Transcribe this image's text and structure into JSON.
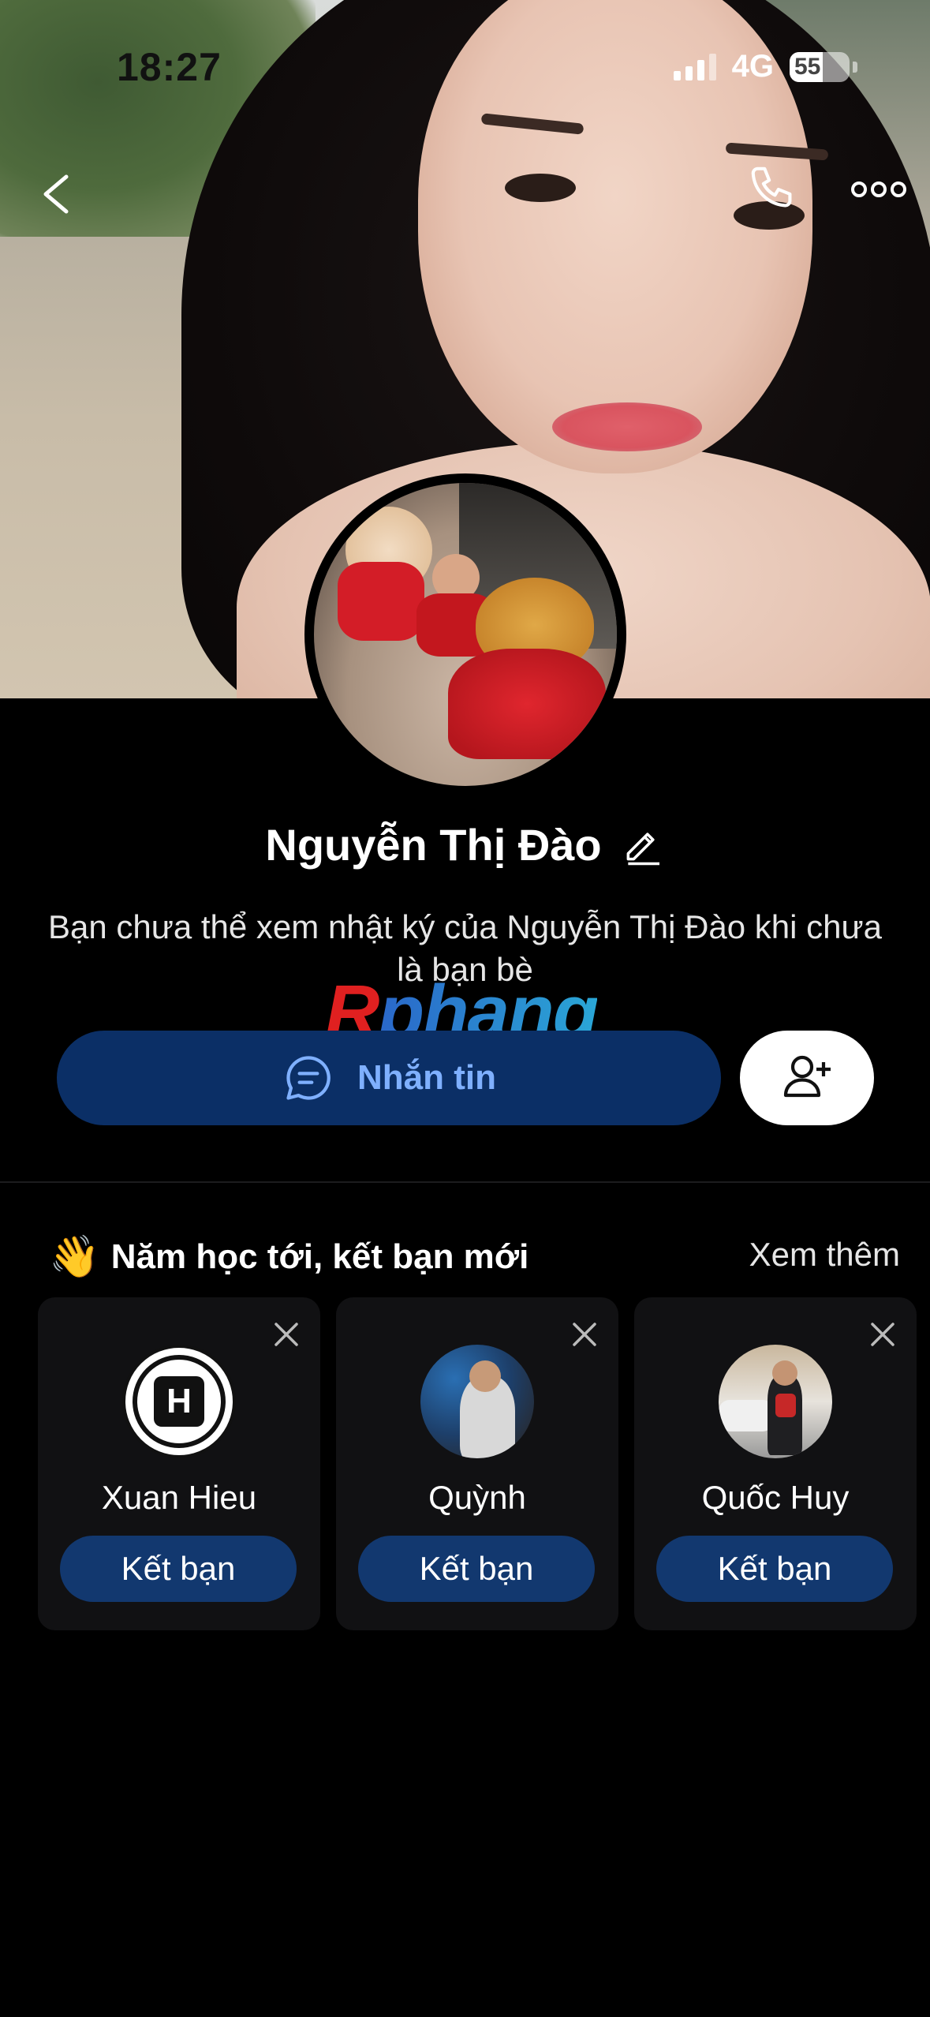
{
  "status_bar": {
    "time": "18:27",
    "network": "4G",
    "battery": "55",
    "battery_level": 0.55
  },
  "nav": {
    "back_icon": "chevron-left-icon",
    "call_icon": "phone-icon",
    "more_icon": "more-dots-icon"
  },
  "profile": {
    "name": "Nguyễn Thị Đào",
    "notice": "Bạn chưa thể xem nhật ký của Nguyễn Thị Đào khi chưa là bạn bè",
    "watermark_r": "R",
    "watermark_rest": "phang"
  },
  "actions": {
    "message_label": "Nhắn tin",
    "add_friend_icon": "add-user-icon"
  },
  "suggestions": {
    "emoji": "👋",
    "title": "Năm học tới, kết bạn mới",
    "see_more": "Xem thêm",
    "items": [
      {
        "name": "Xuan Hieu",
        "button": "Kết bạn",
        "avatar_text": "H"
      },
      {
        "name": "Quỳnh",
        "button": "Kết bạn"
      },
      {
        "name": "Quốc Huy",
        "button": "Kết bạn"
      }
    ]
  },
  "colors": {
    "message_button": "#0b2f66",
    "message_label": "#7fb0ff",
    "add_button": "#12386f",
    "card_bg": "#111113"
  }
}
